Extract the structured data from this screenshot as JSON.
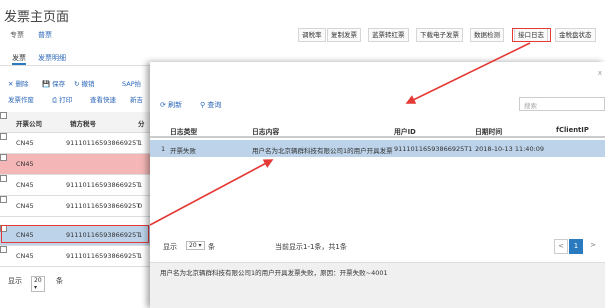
{
  "page": {
    "title": "发票主页面"
  },
  "tabs": [
    {
      "label": "专票"
    },
    {
      "label": "普票"
    }
  ],
  "toolbar": {
    "buttons": [
      {
        "label": "调税率"
      },
      {
        "label": "复制发票"
      },
      {
        "label": "蓝票转红票"
      },
      {
        "label": "下载电子发票"
      },
      {
        "label": "数据检测"
      },
      {
        "label": "接口日志"
      },
      {
        "label": "金税盘状态"
      }
    ]
  },
  "subtabs": [
    {
      "label": "发票"
    },
    {
      "label": "发票明细"
    }
  ],
  "actions": {
    "row1": [
      "删除",
      "保存",
      "撤销",
      "SAP抬"
    ],
    "row2": [
      "发票作废",
      "打印",
      "查看快速",
      "新吉"
    ]
  },
  "bg_table": {
    "headers": [
      "开票公司",
      "销方税号",
      "分"
    ],
    "rows": [
      {
        "company": "CN45",
        "tax_id": "91110116593866925T",
        "extra": "1"
      },
      {
        "company": "CN45",
        "tax_id": "",
        "extra": ""
      },
      {
        "company": "CN45",
        "tax_id": "91110116593866925T",
        "extra": "1"
      },
      {
        "company": "CN45",
        "tax_id": "91110116593866925T",
        "extra": "0"
      },
      {
        "company": "CN45",
        "tax_id": "91110116593866925T",
        "extra": "1"
      },
      {
        "company": "CN45",
        "tax_id": "91110116593866925T",
        "extra": "1"
      }
    ]
  },
  "bg_footer": {
    "show_label": "显示",
    "page_size": "20",
    "unit": "条"
  },
  "modal": {
    "close": "x",
    "refresh_label": "刷新",
    "query_label": "查询",
    "search_placeholder": "搜索",
    "headers": [
      "日志类型",
      "日志内容",
      "用户ID",
      "日期时间",
      "fClientIP"
    ],
    "rows": [
      {
        "index": "1",
        "type": "开票失败",
        "content": "用户名为北京辆群科技有限公司1的用户开具发票",
        "user_id": "91110116593866925T1",
        "datetime": "2018-10-13 11:40:09",
        "client_ip": ""
      }
    ],
    "footer": {
      "show_label": "显示",
      "page_size": "20",
      "unit": "条",
      "summary": "当前显示1-1条，共1条",
      "prev": "<",
      "page": "1",
      "next": ">"
    },
    "detail_text": "用户名为北京辆群科技有限公司1的用户开具发票失败，原因：开票失败~4001"
  },
  "colors": {
    "accent": "#2a7ac0",
    "highlight": "#e53935",
    "fail_row": "#f4b6b6",
    "selected_row": "#bcd3ea"
  }
}
